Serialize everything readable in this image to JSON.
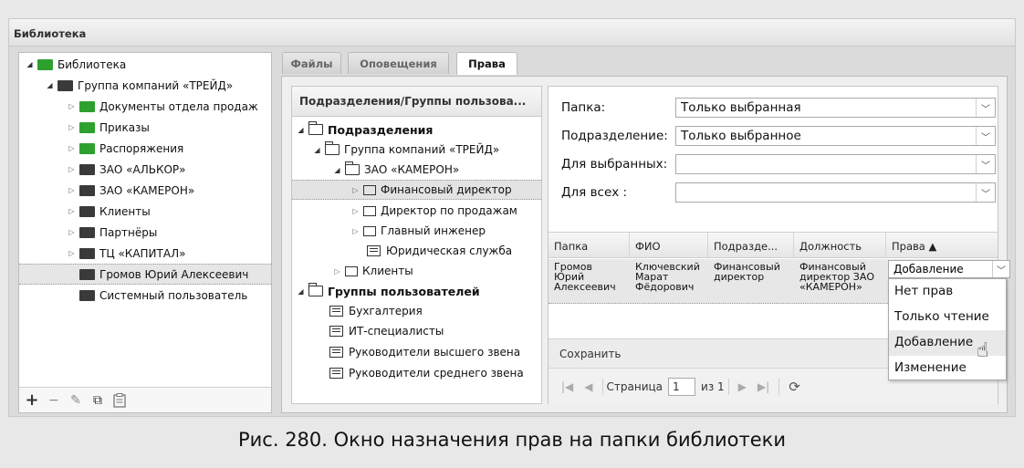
{
  "window": {
    "title": "Библиотека"
  },
  "left_tree": {
    "items": [
      {
        "label": "Библиотека",
        "level": 0,
        "expanded": true,
        "icon": "green-folder-icon"
      },
      {
        "label": "Группа компаний «ТРЕЙД»",
        "level": 1,
        "expanded": true,
        "icon": "dark-folder-icon"
      },
      {
        "label": "Документы отдела продаж",
        "level": 2,
        "expanded": false,
        "icon": "green-folder-icon"
      },
      {
        "label": "Приказы",
        "level": 2,
        "expanded": false,
        "icon": "green-folder-icon"
      },
      {
        "label": "Распоряжения",
        "level": 2,
        "expanded": false,
        "icon": "green-folder-icon"
      },
      {
        "label": "ЗАО «АЛЬКОР»",
        "level": 2,
        "expanded": false,
        "icon": "dark-folder-icon"
      },
      {
        "label": "ЗАО «КАМЕРОН»",
        "level": 2,
        "expanded": false,
        "icon": "dark-folder-icon"
      },
      {
        "label": "Клиенты",
        "level": 2,
        "expanded": false,
        "icon": "dark-folder-icon"
      },
      {
        "label": "Партнёры",
        "level": 2,
        "expanded": false,
        "icon": "dark-folder-icon"
      },
      {
        "label": "ТЦ «КАПИТАЛ»",
        "level": 2,
        "expanded": false,
        "icon": "dark-folder-icon"
      },
      {
        "label": "Громов Юрий Алексеевич",
        "level": 2,
        "selected": true,
        "icon": "dark-folder-icon"
      },
      {
        "label": "Системный пользователь",
        "level": 2,
        "icon": "dark-folder-icon"
      }
    ],
    "toolbar": {
      "add": "+",
      "remove": "−",
      "edit": "✎",
      "copy": "⧉",
      "paste": "📋"
    }
  },
  "tabs": [
    {
      "label": "Файлы",
      "active": false
    },
    {
      "label": "Оповещения",
      "active": false
    },
    {
      "label": "Права",
      "active": true
    }
  ],
  "groups": {
    "header": "Подразделения/Группы пользова...",
    "items": [
      {
        "label": "Подразделения",
        "bold": true
      },
      {
        "label": "Группа компаний «ТРЕЙД»"
      },
      {
        "label": "ЗАО «КАМЕРОН»"
      },
      {
        "label": "Финансовый директор",
        "selected": true
      },
      {
        "label": "Директор по продажам"
      },
      {
        "label": "Главный инженер"
      },
      {
        "label": "Юридическая служба"
      },
      {
        "label": "Клиенты"
      },
      {
        "label": "Группы пользователей",
        "bold": true
      },
      {
        "label": "Бухгалтерия"
      },
      {
        "label": "ИТ-специалисты"
      },
      {
        "label": "Руководители высшего звена"
      },
      {
        "label": "Руководители среднего звена"
      }
    ]
  },
  "form": {
    "folder_label": "Папка:",
    "folder_value": "Только выбранная",
    "dept_label": "Подразделение:",
    "dept_value": "Только выбранное",
    "selected_label": "Для выбранных:",
    "selected_value": "",
    "all_label": "Для всех :",
    "all_value": ""
  },
  "grid": {
    "columns": [
      "Папка",
      "ФИО",
      "Подразде...",
      "Должность",
      "Права ▲"
    ],
    "rows": [
      {
        "folder": "Громов\nЮрий\nАлексеевич",
        "fio": "Ключевский\nМарат\nФёдорович",
        "dept": "Финансовый\nдиректор",
        "position": "Финансовый\nдиректор ЗАО\n«КАМЕРОН»",
        "rights": "Добавление"
      }
    ],
    "rights_options": [
      "Нет прав",
      "Только чтение",
      "Добавление",
      "Изменение"
    ],
    "hovered_option": "Добавление"
  },
  "save_label": "Сохранить",
  "pager": {
    "page_label": "Страница",
    "page": "1",
    "of": "из 1"
  },
  "caption": "Рис. 280. Окно назначения прав на папки библиотеки"
}
